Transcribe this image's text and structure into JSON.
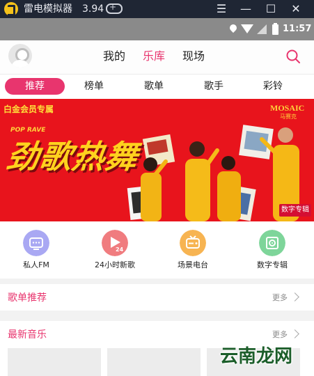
{
  "emulator": {
    "title": "雷电模拟器",
    "version": "3.94",
    "controls": [
      "menu-icon",
      "minimize-icon",
      "maximize-icon",
      "close-icon"
    ]
  },
  "status_bar": {
    "time": "11:57"
  },
  "header": {
    "tabs": [
      {
        "label": "我的",
        "active": false
      },
      {
        "label": "乐库",
        "active": true
      },
      {
        "label": "现场",
        "active": false
      }
    ],
    "accent": "#e8356e"
  },
  "sub_tabs": [
    {
      "label": "推荐",
      "active": true
    },
    {
      "label": "榜单",
      "active": false
    },
    {
      "label": "歌单",
      "active": false
    },
    {
      "label": "歌手",
      "active": false
    },
    {
      "label": "彩铃",
      "active": false
    }
  ],
  "banner": {
    "tag": "白金会员专属",
    "brand": "MOSAIC",
    "brand_sub": "马赛克",
    "kicker": "POP RAVE",
    "headline": "劲歌热舞",
    "badge": "数字专辑",
    "background": "#e8141c"
  },
  "quick_entries": [
    {
      "label": "私人FM",
      "icon": "radio-icon",
      "color": "#a9a8f3"
    },
    {
      "label": "24小时新歌",
      "icon": "play-24-icon",
      "color": "#f07c7f"
    },
    {
      "label": "场景电台",
      "icon": "tv-radio-icon",
      "color": "#f7b452"
    },
    {
      "label": "数字专辑",
      "icon": "album-icon",
      "color": "#7ed59a"
    }
  ],
  "sections": {
    "playlist": {
      "title": "歌单推荐",
      "more": "更多"
    },
    "new_music": {
      "title": "最新音乐",
      "more": "更多"
    }
  },
  "watermark": "云南龙网"
}
